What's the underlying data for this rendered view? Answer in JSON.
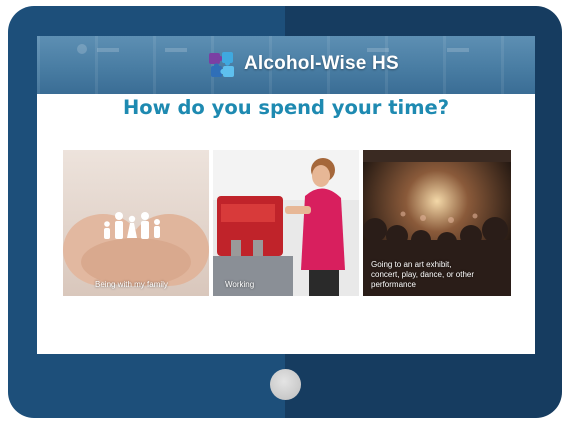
{
  "banner": {
    "brand": "Alcohol-Wise HS",
    "logo_icon": "puzzle-pieces-icon"
  },
  "main": {
    "heading": "How do you spend your time?"
  },
  "options": [
    {
      "caption": "Being with my family"
    },
    {
      "caption": "Working"
    },
    {
      "caption": "Going to an art exhibit, concert, play, dance, or other performance"
    }
  ],
  "colors": {
    "tablet_frame": "#1d4f7a",
    "heading": "#1e8ab1",
    "banner": "#497da3"
  }
}
